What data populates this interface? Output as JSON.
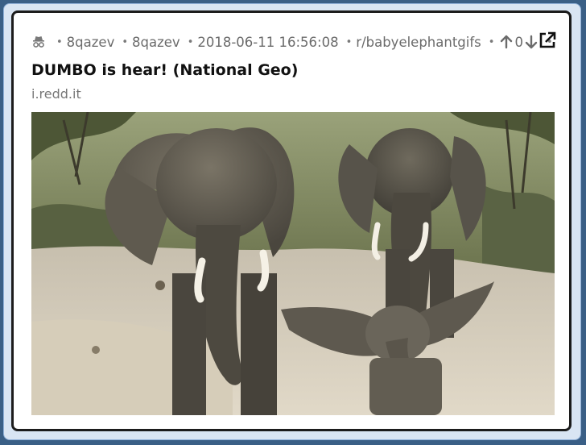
{
  "post": {
    "author": "8qazev",
    "author_flair": "8qazev",
    "timestamp": "2018-06-11 16:56:08",
    "subreddit": "r/babyelephantgifs",
    "score": "0",
    "title": "DUMBO is hear! (National Geo)",
    "domain": "i.redd.it"
  },
  "icons": {
    "anon": "incognito-icon",
    "up": "arrow-up-icon",
    "down": "arrow-down-icon",
    "external": "external-link-icon"
  },
  "colors": {
    "frame_bg": "#3a5f86",
    "card_border": "#1c1c1c",
    "meta_text": "#6b6b6b"
  }
}
